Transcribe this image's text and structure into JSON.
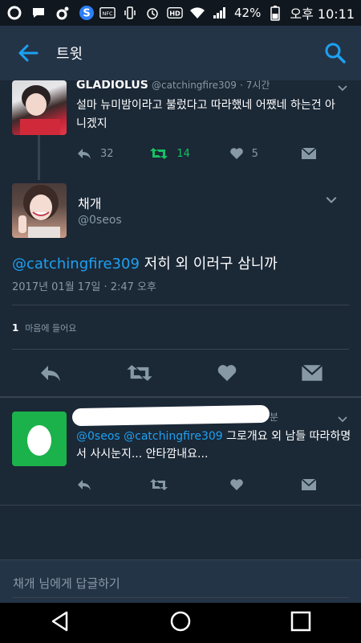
{
  "status": {
    "battery": "42%",
    "time": "오후 10:11"
  },
  "header": {
    "title": "트윗"
  },
  "parent_tweet": {
    "name": "GLADIOLUS",
    "handle": "@catchingfire309",
    "time": "· 7시간",
    "text_line1": "설마 뉴미밤이라고 불렀다고 따라했네 어쨌네 하는건 아",
    "text_line2": "니겠지",
    "reply_count": "32",
    "retweet_count": "14",
    "like_count": "5"
  },
  "main_tweet": {
    "name": "채개",
    "handle": "@0seos",
    "mention": "@catchingfire309",
    "text": "저히 외 이러구 삼니까",
    "timestamp": "2017년 01월 17일 · 2:47 오후",
    "likes_count": "1",
    "likes_label": "마음에 들어요"
  },
  "reply_tweet": {
    "time_suffix": "분",
    "mentions": "@0seos @catchingfire309",
    "text_line1": "그로개요 외 남들 따라하명",
    "text_line2": "서 사시눈지... 안타깜내요..."
  },
  "reply_bar": {
    "placeholder": "채개 님에게 답글하기"
  },
  "colors": {
    "background": "#1b2836",
    "appbar": "#243447",
    "accent": "#1da1f2",
    "retweet_green": "#17bf63",
    "muted": "#8899a6"
  }
}
